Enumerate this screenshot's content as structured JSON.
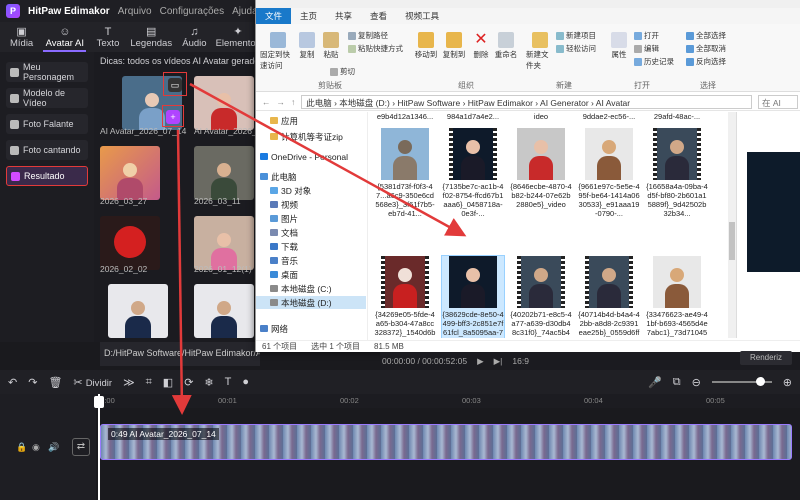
{
  "app": {
    "name": "HitPaw Edimakor",
    "menus": [
      "Arquivo",
      "Configurações",
      "Ajuda"
    ]
  },
  "toolbar": {
    "tools": [
      {
        "label": "Mídia",
        "icon": "media-icon"
      },
      {
        "label": "Avatar AI",
        "icon": "avatar-icon"
      },
      {
        "label": "Texto",
        "icon": "text-icon"
      },
      {
        "label": "Legendas",
        "icon": "captions-icon"
      },
      {
        "label": "Áudio",
        "icon": "audio-icon"
      },
      {
        "label": "Elementos",
        "icon": "elements-icon"
      }
    ]
  },
  "sidebar": {
    "items": [
      {
        "label": "Meu Personagem"
      },
      {
        "label": "Modelo de Vídeo"
      },
      {
        "label": "Foto Falante"
      },
      {
        "label": "Foto cantando"
      },
      {
        "label": "Resultado"
      }
    ]
  },
  "content": {
    "tip": "Dicas: todos os vídeos AI Avatar gerados fo",
    "thumbs": [
      {
        "label": "AI Avatar_2026_07_14"
      },
      {
        "label": "AI Avatar_2026_05_1"
      },
      {
        "label": "2026_03_27"
      },
      {
        "label": "2026_03_11"
      },
      {
        "label": "2026_02_02"
      },
      {
        "label": "2026_01_12(1)"
      },
      {
        "label": ""
      },
      {
        "label": ""
      }
    ],
    "path": "D:/HitPaw Software/HitPaw Edimakor/AI Gen"
  },
  "timeline": {
    "split_label": "Dividir",
    "ticks": [
      "00:00",
      "00:01",
      "00:02",
      "00:03",
      "00:04",
      "00:05"
    ],
    "clip_label": "0:49  AI Avatar_2026_07_14"
  },
  "player": {
    "time": "00:00:00 / 00:00:52:05",
    "ratio": "16:9",
    "render": "Renderiz"
  },
  "explorer": {
    "tabs": [
      "文件",
      "主页",
      "共享",
      "查看",
      "视频工具"
    ],
    "ribbon": {
      "big_buttons": [
        "固定到快速访问",
        "复制",
        "粘贴",
        "移动到",
        "复制到",
        "删除",
        "重命名",
        "新建文件夹",
        "属性"
      ],
      "small_buttons": [
        "复制路径",
        "粘贴快捷方式",
        "剪切",
        "新建项目",
        "轻松访问",
        "打开",
        "编辑",
        "历史记录",
        "全部选择",
        "全部取消",
        "反向选择"
      ],
      "groups": [
        "剪贴板",
        "组织",
        "新建",
        "打开",
        "选择"
      ]
    },
    "address": {
      "path": "此电脑  ›  本地磁盘 (D:)  ›  HitPaw Software  ›  HitPaw Edimakor  ›  AI Generator  ›  AI Avatar",
      "search_placeholder": "在 AI"
    },
    "nav": [
      {
        "label": "应用",
        "color": "#e8b64c"
      },
      {
        "label": "计算机等考证zip",
        "color": "#e8b64c"
      },
      {
        "label": "OneDrive - Personal",
        "color": "#1b7be0"
      },
      {
        "label": "此电脑",
        "color": "#4a90d9"
      },
      {
        "label": "3D 对象",
        "color": "#5aa6e6"
      },
      {
        "label": "视频",
        "color": "#5a7ab8"
      },
      {
        "label": "图片",
        "color": "#5a9ad8"
      },
      {
        "label": "文档",
        "color": "#7a8ab0"
      },
      {
        "label": "下载",
        "color": "#3a78c8"
      },
      {
        "label": "音乐",
        "color": "#4a80c8"
      },
      {
        "label": "桌面",
        "color": "#3a8ad8"
      },
      {
        "label": "本地磁盘 (C:)",
        "color": "#8a8a8a"
      },
      {
        "label": "本地磁盘 (D:)",
        "color": "#8a8a8a"
      },
      {
        "label": "网络",
        "color": "#4a80c8"
      }
    ],
    "top_row_partial": [
      "e9b4d12a1346...",
      "984a1d7a4e2...",
      "ideo",
      "9ddae2-ec56-...",
      "29afd-48ac-..."
    ],
    "files": [
      {
        "name": "{5381d73f-f0f3-47...a6c9-350e6cd568e3}_3f61f7b5-eb7d-41...",
        "kind": "donkey"
      },
      {
        "name": "{7135be7c-ac1b-4f02-8754-ffcd67b1aaa6}_0458718a-0e3f-...",
        "kind": "woman-dark"
      },
      {
        "name": "{8646ecbe-4870-4b82-b244-07e62b2880e5}_video",
        "kind": "woman-red"
      },
      {
        "name": "{9661e97c-5e5e-495f-be64-1414a0630533}_e91aaa19-0790-...",
        "kind": "knights"
      },
      {
        "name": "{16658a4a-09ba-4d5f-bf80-2b601a15889f}_9d42502b32b34...",
        "kind": "man"
      },
      {
        "name": "{34269e05-5fde-4a65-b304-47a8cc328372}_1540d6b1b0c0...",
        "kind": "santa"
      },
      {
        "name": "{38629cde-8e50-4499-bff3-2c851e7f61fcl_8a5095aa-7f37-...",
        "kind": "woman-dark"
      },
      {
        "name": "{40202b71-e8c5-4a77-a639-d30db48c31f0}_74ac5b48eef04...",
        "kind": "man"
      },
      {
        "name": "{40714b4d-b4a4-42bb-a8d8-2c9391eae25b}_0559d6ff-d9a...",
        "kind": "man"
      },
      {
        "name": "{33476623-ae49-41bf-b693-4565d4e7abc1}_73d71045-55c4...",
        "kind": "knights"
      }
    ],
    "status": {
      "count": "61 个项目",
      "selected": "选中 1 个项目",
      "size": "81.5 MB"
    }
  },
  "colors": {
    "accent": "#8a6bff",
    "highlight_red": "#e23a3a",
    "explorer_blue": "#1979ca"
  }
}
